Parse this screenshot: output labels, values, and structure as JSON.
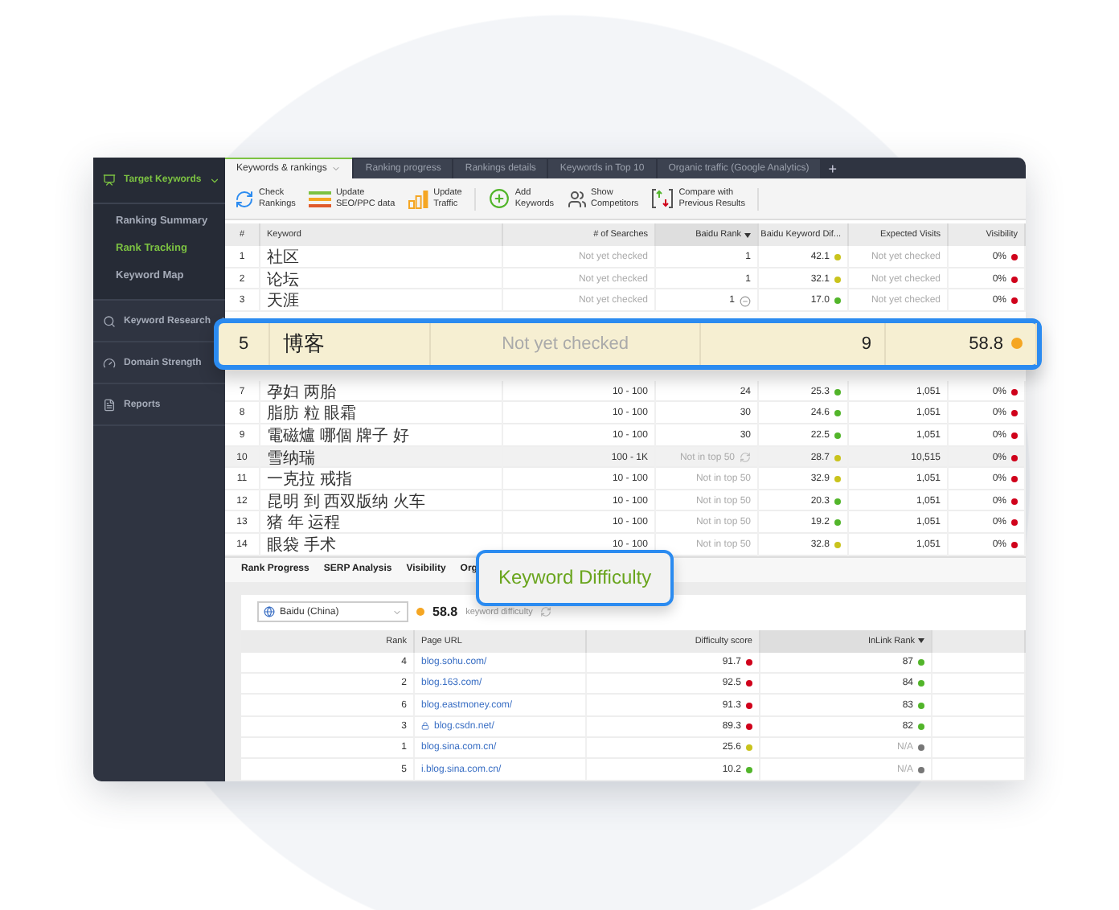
{
  "sidebar": {
    "sections": [
      {
        "label": "Target Keywords",
        "expanded": true,
        "items": [
          {
            "label": "Ranking Summary",
            "selected": false
          },
          {
            "label": "Rank Tracking",
            "selected": true
          },
          {
            "label": "Keyword Map",
            "selected": false
          }
        ]
      },
      {
        "label": "Keyword Research",
        "expanded": false
      },
      {
        "label": "Domain Strength"
      },
      {
        "label": "Reports"
      }
    ]
  },
  "tabs": [
    {
      "label": "Keywords & rankings",
      "selected": true
    },
    {
      "label": "Ranking progress",
      "selected": false
    },
    {
      "label": "Rankings details",
      "selected": false
    },
    {
      "label": "Keywords in Top 10",
      "selected": false
    },
    {
      "label": "Organic traffic (Google Analytics)",
      "selected": false
    }
  ],
  "new_tab": "+",
  "toolbar": [
    {
      "label": "Check\nRankings"
    },
    {
      "label": "Update\nSEO/PPC data"
    },
    {
      "label": "Update\nTraffic"
    },
    {
      "label": "Add\nKeywords"
    },
    {
      "label": "Show\nCompetitors"
    },
    {
      "label": "Compare with\nPrevious Results"
    }
  ],
  "table": {
    "columns": [
      {
        "label": "#",
        "sorted": false
      },
      {
        "label": "Keyword",
        "sorted": false
      },
      {
        "label": "# of Searches",
        "sorted": false
      },
      {
        "label": "Baidu Rank",
        "sorted": true
      },
      {
        "label": "Baidu Keyword Dif...",
        "sorted": false
      },
      {
        "label": "Expected Visits",
        "sorted": false
      },
      {
        "label": "Visibility",
        "sorted": false
      }
    ],
    "zoomed_row": {
      "num": "5",
      "keyword": "博客",
      "searches": "Not yet checked",
      "rank": "9",
      "difficulty": {
        "text": "58.8",
        "color": "#f5a623"
      }
    },
    "rows": [
      {
        "num": "1",
        "keyword": "社区",
        "searches": "Not yet checked",
        "checked": false,
        "rank": "1",
        "in_top_50": true,
        "difficulty": {
          "text": "42.1",
          "color": "#c9c31c"
        },
        "visits": "Not yet checked",
        "visibility": {
          "text": "0%",
          "color": "#d0021b"
        }
      },
      {
        "num": "2",
        "keyword": "论坛",
        "searches": "Not yet checked",
        "checked": false,
        "rank": "1",
        "in_top_50": true,
        "difficulty": {
          "text": "32.1",
          "color": "#c9c31c"
        },
        "visits": "Not yet checked",
        "visibility": {
          "text": "0%",
          "color": "#d0021b"
        }
      },
      {
        "num": "3",
        "keyword": "天涯",
        "searches": "Not yet checked",
        "checked": false,
        "rank": "1",
        "in_top_50": true,
        "unchanged": true,
        "difficulty": {
          "text": "17.0",
          "color": "#52b52a"
        },
        "visits": "Not yet checked",
        "visibility": {
          "text": "0%",
          "color": "#d0021b"
        }
      },
      {
        "num": "7",
        "keyword": "孕妇 两胎",
        "searches": "10 - 100",
        "checked": true,
        "rank": "24",
        "in_top_50": true,
        "difficulty": {
          "text": "25.3",
          "color": "#52b52a"
        },
        "visits": "1,051",
        "visibility": {
          "text": "0%",
          "color": "#d0021b"
        }
      },
      {
        "num": "8",
        "keyword": "脂肪 粒 眼霜",
        "searches": "10 - 100",
        "checked": true,
        "rank": "30",
        "in_top_50": true,
        "difficulty": {
          "text": "24.6",
          "color": "#52b52a"
        },
        "visits": "1,051",
        "visibility": {
          "text": "0%",
          "color": "#d0021b"
        }
      },
      {
        "num": "9",
        "keyword": "電磁爐 哪個 牌子 好",
        "searches": "10 - 100",
        "checked": true,
        "rank": "30",
        "in_top_50": true,
        "difficulty": {
          "text": "22.5",
          "color": "#52b52a"
        },
        "visits": "1,051",
        "visibility": {
          "text": "0%",
          "color": "#d0021b"
        }
      },
      {
        "num": "10",
        "keyword": "雪纳瑞",
        "searches": "100 - 1K",
        "checked": true,
        "rank": "Not in top 50",
        "in_top_50": false,
        "refreshing": true,
        "difficulty": {
          "text": "28.7",
          "color": "#c9c31c"
        },
        "visits": "10,515",
        "visibility": {
          "text": "0%",
          "color": "#d0021b"
        }
      },
      {
        "num": "11",
        "keyword": "一克拉 戒指",
        "searches": "10 - 100",
        "checked": true,
        "rank": "Not in top 50",
        "in_top_50": false,
        "difficulty": {
          "text": "32.9",
          "color": "#c9c31c"
        },
        "visits": "1,051",
        "visibility": {
          "text": "0%",
          "color": "#d0021b"
        }
      },
      {
        "num": "12",
        "keyword": "昆明 到 西双版纳 火车",
        "searches": "10 - 100",
        "checked": true,
        "rank": "Not in top 50",
        "in_top_50": false,
        "difficulty": {
          "text": "20.3",
          "color": "#52b52a"
        },
        "visits": "1,051",
        "visibility": {
          "text": "0%",
          "color": "#d0021b"
        }
      },
      {
        "num": "13",
        "keyword": "猪 年 运程",
        "searches": "10 - 100",
        "checked": true,
        "rank": "Not in top 50",
        "in_top_50": false,
        "difficulty": {
          "text": "19.2",
          "color": "#52b52a"
        },
        "visits": "1,051",
        "visibility": {
          "text": "0%",
          "color": "#d0021b"
        }
      },
      {
        "num": "14",
        "keyword": "眼袋 手术",
        "searches": "10 - 100",
        "checked": true,
        "rank": "Not in top 50",
        "in_top_50": false,
        "difficulty": {
          "text": "32.8",
          "color": "#c9c31c"
        },
        "visits": "1,051",
        "visibility": {
          "text": "0%",
          "color": "#d0021b"
        }
      }
    ]
  },
  "bottom_tabs": [
    {
      "label": "Rank Progress",
      "selected": false
    },
    {
      "label": "SERP Analysis",
      "selected": false
    },
    {
      "label": "Visibility",
      "selected": false
    },
    {
      "label": "Org",
      "selected": false
    },
    {
      "label": "Keyword Difficulty",
      "selected": true
    }
  ],
  "difficulty_panel": {
    "engine": "Baidu (China)",
    "score": {
      "text": "58.8",
      "color": "#f5a623"
    },
    "score_label": "keyword difficulty",
    "columns": [
      {
        "label": "Rank",
        "sorted": false
      },
      {
        "label": "Page URL",
        "sorted": false
      },
      {
        "label": "Difficulty score",
        "sorted": false
      },
      {
        "label": "InLink Rank",
        "sorted": true
      }
    ],
    "rows": [
      {
        "rank": "4",
        "url": "blog.sohu.com/",
        "secure": false,
        "difficulty": {
          "text": "91.7",
          "color": "#d0021b"
        },
        "inlink": {
          "text": "87",
          "color": "#52b52a"
        }
      },
      {
        "rank": "2",
        "url": "blog.163.com/",
        "secure": false,
        "difficulty": {
          "text": "92.5",
          "color": "#d0021b"
        },
        "inlink": {
          "text": "84",
          "color": "#52b52a"
        }
      },
      {
        "rank": "6",
        "url": "blog.eastmoney.com/",
        "secure": false,
        "difficulty": {
          "text": "91.3",
          "color": "#d0021b"
        },
        "inlink": {
          "text": "83",
          "color": "#52b52a"
        }
      },
      {
        "rank": "3",
        "url": "blog.csdn.net/",
        "secure": true,
        "difficulty": {
          "text": "89.3",
          "color": "#d0021b"
        },
        "inlink": {
          "text": "82",
          "color": "#52b52a"
        }
      },
      {
        "rank": "1",
        "url": "blog.sina.com.cn/",
        "secure": false,
        "difficulty": {
          "text": "25.6",
          "color": "#c9c31c"
        },
        "inlink": {
          "text": "N/A",
          "color": "#777777"
        }
      },
      {
        "rank": "5",
        "url": "i.blog.sina.com.cn/",
        "secure": false,
        "difficulty": {
          "text": "10.2",
          "color": "#52b52a"
        },
        "inlink": {
          "text": "N/A",
          "color": "#777777"
        }
      }
    ]
  }
}
